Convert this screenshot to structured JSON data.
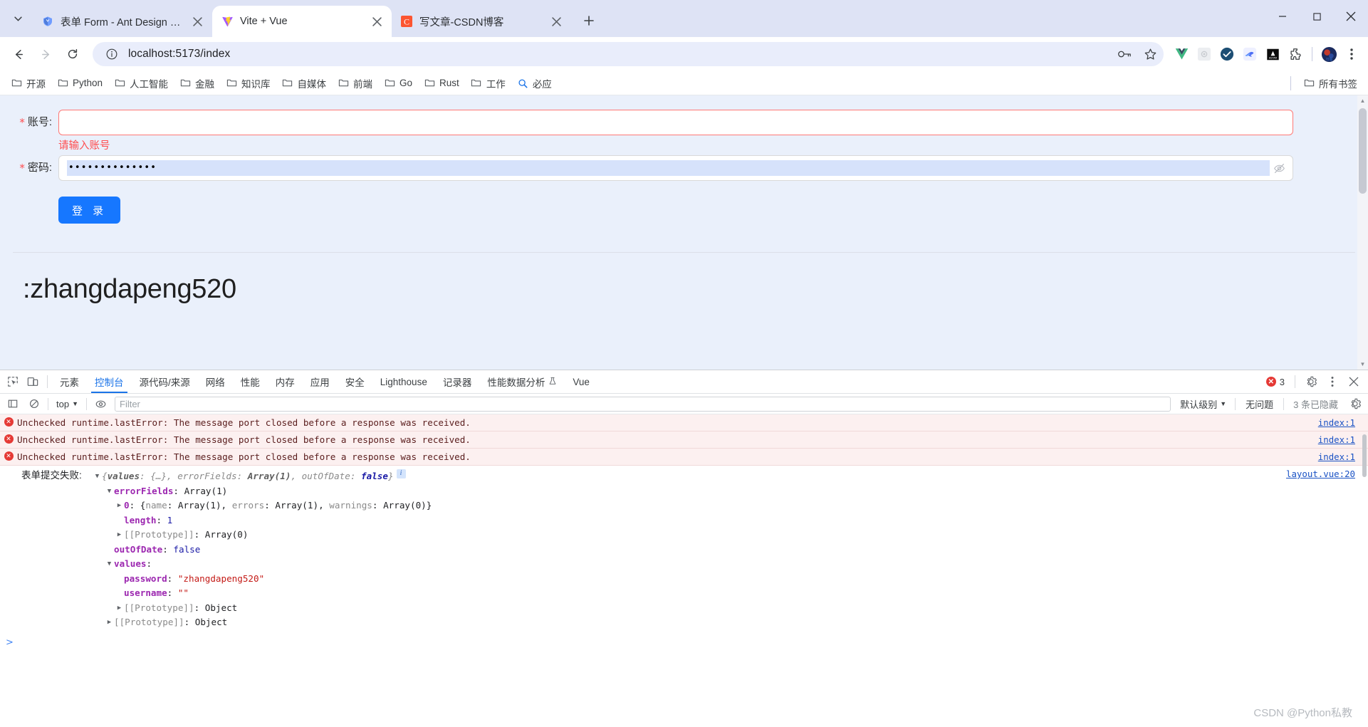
{
  "browser": {
    "tabs": [
      {
        "title": "表单 Form - Ant Design Vue",
        "favicon": "ant-design-vue-icon",
        "active": false
      },
      {
        "title": "Vite + Vue",
        "favicon": "vite-icon",
        "active": true
      },
      {
        "title": "写文章-CSDN博客",
        "favicon": "csdn-icon",
        "active": false
      }
    ],
    "new_tab_label": "+",
    "window_controls": [
      "minimize",
      "maximize",
      "close"
    ],
    "nav": {
      "back": "back-arrow",
      "forward": "forward-arrow",
      "reload": "reload"
    },
    "omnibox": {
      "url": "localhost:5173/index",
      "site_info_icon": "info-circle-icon",
      "trailing_icons": [
        "password-key-icon",
        "bookmark-star-icon"
      ]
    },
    "extensions": [
      "vue-devtools-icon",
      "grid-extension-icon",
      "checkmark-extension-icon",
      "bird-extension-icon",
      "astar-extension-icon",
      "puzzle-extensions-icon"
    ],
    "profile_icon": "profile-avatar",
    "menu_icon": "three-dot-menu-icon",
    "bookmarks": [
      {
        "label": "开源",
        "icon": "folder-icon"
      },
      {
        "label": "Python",
        "icon": "folder-icon"
      },
      {
        "label": "人工智能",
        "icon": "folder-icon"
      },
      {
        "label": "金融",
        "icon": "folder-icon"
      },
      {
        "label": "知识库",
        "icon": "folder-icon"
      },
      {
        "label": "自媒体",
        "icon": "folder-icon"
      },
      {
        "label": "前端",
        "icon": "folder-icon"
      },
      {
        "label": "Go",
        "icon": "folder-icon"
      },
      {
        "label": "Rust",
        "icon": "folder-icon"
      },
      {
        "label": "工作",
        "icon": "folder-icon"
      },
      {
        "label": "必应",
        "icon": "search-icon"
      }
    ],
    "bookmarks_all": "所有书签"
  },
  "page": {
    "form": {
      "username": {
        "label": "账号:",
        "required_mark": "*",
        "value": "",
        "error": "请输入账号",
        "has_error": true
      },
      "password": {
        "label": "密码:",
        "required_mark": "*",
        "value": "••••••••••••••",
        "eye_icon": "eye-invisible-icon"
      },
      "submit_label": "登 录"
    },
    "heading": ":zhangdapeng520",
    "watermark": "CSDN @Python私教"
  },
  "devtools": {
    "left_icons": [
      "inspect-element-icon",
      "device-toolbar-icon"
    ],
    "tabs": [
      {
        "label": "元素",
        "active": false
      },
      {
        "label": "控制台",
        "active": true
      },
      {
        "label": "源代码/来源",
        "active": false
      },
      {
        "label": "网络",
        "active": false
      },
      {
        "label": "性能",
        "active": false
      },
      {
        "label": "内存",
        "active": false
      },
      {
        "label": "应用",
        "active": false
      },
      {
        "label": "安全",
        "active": false
      },
      {
        "label": "Lighthouse",
        "active": false
      },
      {
        "label": "记录器",
        "active": false
      },
      {
        "label": "性能数据分析",
        "active": false,
        "trailing_icon": "flask-icon"
      },
      {
        "label": "Vue",
        "active": false
      }
    ],
    "error_count": "3",
    "right_icons": [
      "settings-gear-icon",
      "devtools-more-icon",
      "devtools-close-icon"
    ],
    "console_toolbar": {
      "sidebar_icon": "console-sidebar-icon",
      "clear_icon": "clear-console-icon",
      "context": "top",
      "eye_icon": "live-expression-icon",
      "filter_placeholder": "Filter",
      "filter_value": "",
      "level": "默认级别",
      "issues": "无问题",
      "hidden": "3 条已隐藏",
      "settings_icon": "console-settings-icon"
    },
    "messages": [
      {
        "type": "error",
        "text": "Unchecked runtime.lastError: The message port closed before a response was received.",
        "source": "index:1"
      },
      {
        "type": "error",
        "text": "Unchecked runtime.lastError: The message port closed before a response was received.",
        "source": "index:1"
      },
      {
        "type": "error",
        "text": "Unchecked runtime.lastError: The message port closed before a response was received.",
        "source": "index:1"
      }
    ],
    "log": {
      "label": "表单提交失败:",
      "source": "layout.vue:20",
      "preview_open": "{",
      "preview_values_key": "values",
      "preview_values_val": "{…}",
      "preview_errorfields_key": "errorFields",
      "preview_errorfields_val": "Array(1)",
      "preview_outofdate_key": "outOfDate",
      "preview_outofdate_val": "false",
      "preview_close": "}",
      "info_badge": "i",
      "rows": {
        "errorFields_key": "errorFields",
        "errorFields_val": "Array(1)",
        "zero_key": "0",
        "zero_val_open": "{",
        "zero_name": "name",
        "zero_name_val": "Array(1)",
        "zero_errors": "errors",
        "zero_errors_val": "Array(1)",
        "zero_warnings": "warnings",
        "zero_warnings_val": "Array(0)",
        "zero_val_close": "}",
        "length_key": "length",
        "length_val": "1",
        "proto_key": "[[Prototype]]",
        "proto_array_val": "Array(0)",
        "outOfDate_key": "outOfDate",
        "outOfDate_val": "false",
        "values_key": "values",
        "password_key": "password",
        "password_val": "\"zhangdapeng520\"",
        "username_key": "username",
        "username_val": "\"\"",
        "proto_obj_val": "Object"
      }
    },
    "prompt_caret": ">"
  },
  "colors": {
    "accent_blue": "#1677ff",
    "error_red": "#ff4d4f",
    "devtools_active": "#1a73e8",
    "page_bg": "#eaf0fb"
  }
}
